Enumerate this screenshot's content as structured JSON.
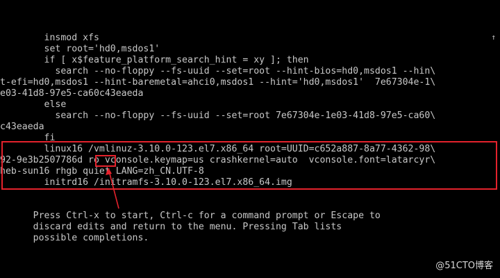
{
  "editor": {
    "lines": [
      "        insmod xfs",
      "        set root='hd0,msdos1'",
      "        if [ x$feature_platform_search_hint = xy ]; then",
      "          search --no-floppy --fs-uuid --set=root --hint-bios=hd0,msdos1 --hin\\",
      "t-efi=hd0,msdos1 --hint-baremetal=ahci0,msdos1 --hint='hd0,msdos1'  7e67304e-1\\",
      "e03-41d8-97e5-ca60c43eaeda",
      "        else",
      "          search --no-floppy --fs-uuid --set=root 7e67304e-1e03-41d8-97e5-ca60\\",
      "c43eaeda",
      "        fi",
      "        linux16 /vmlinuz-3.10.0-123.el7.x86_64 root=UUID=c652a887-8a77-4362-98\\",
      "92-9e3b2507786d ro vconsole.keymap=us crashkernel=auto  vconsole.font=latarcyr\\",
      "heb-sun16 rhgb quiet LANG=zh_CN.UTF-8",
      "        initrd16 /initramfs-3.10.0-123.el7.x86_64.img"
    ],
    "scroll_indicator": "↑"
  },
  "help": {
    "lines": [
      "      Press Ctrl-x to start, Ctrl-c for a command prompt or Escape to",
      "      discard edits and return to the menu. Pressing Tab lists",
      "      possible completions."
    ]
  },
  "annotation": {
    "highlight_color": "#e4222c",
    "highlighted_token": "ro"
  },
  "watermark": {
    "text": "@51CTO博客"
  }
}
